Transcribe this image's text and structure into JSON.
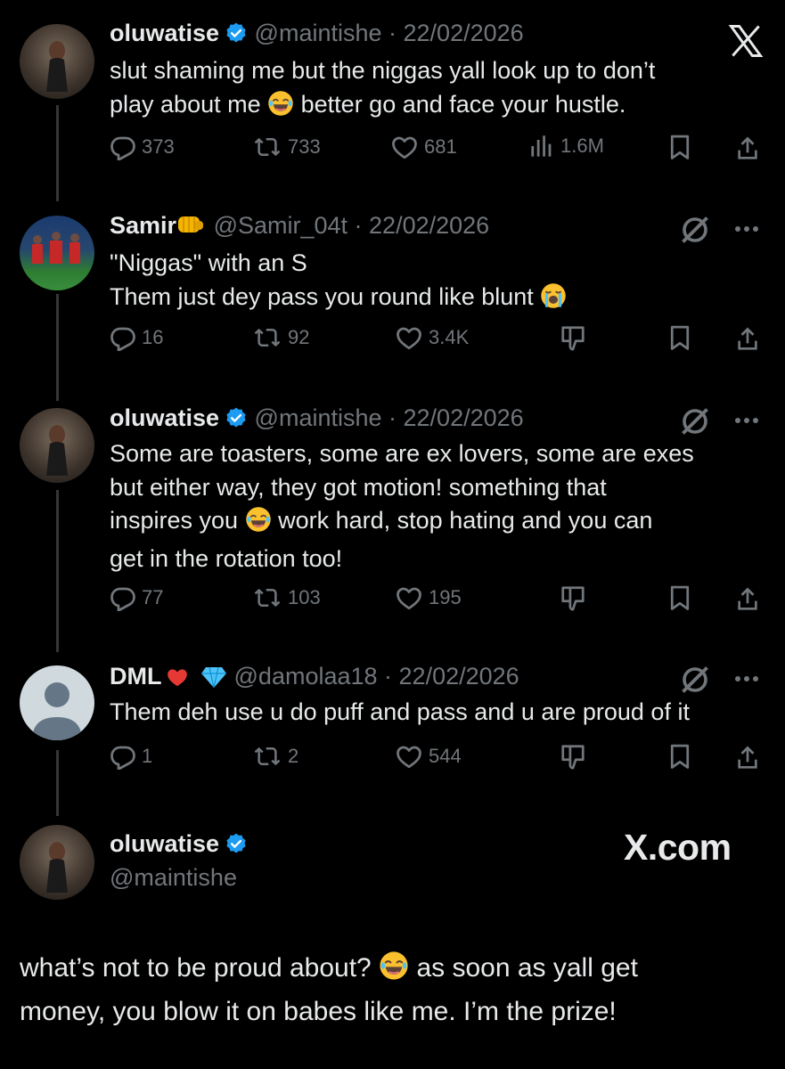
{
  "close_label": "X",
  "tweets": [
    {
      "name": "oluwatise",
      "handle": "@maintishe",
      "date": "22/02/2026",
      "text_a": "slut shaming me but the niggas yall look up to don’t",
      "text_b": "play about me",
      "text_c": "better go and face your hustle.",
      "replies": "373",
      "reposts": "733",
      "likes": "681",
      "views": "1.6M"
    },
    {
      "name": "Samir",
      "handle": "@Samir_04t",
      "date": "22/02/2026",
      "text_a": "\"Niggas\" with an S",
      "text_b": "Them just dey pass you round like blunt",
      "replies": "16",
      "reposts": "92",
      "likes": "3.4K"
    },
    {
      "name": "oluwatise",
      "handle": "@maintishe",
      "date": "22/02/2026",
      "text_a": "Some are toasters, some are ex lovers, some are exes",
      "text_b": "but either way, they got motion! something that",
      "text_c": "inspires you",
      "text_d": "work hard, stop hating and you can",
      "text_e": "get in the rotation too!",
      "replies": "77",
      "reposts": "103",
      "likes": "195"
    },
    {
      "name": "DML",
      "handle": "@damolaa18",
      "date": "22/02/2026",
      "text_a": "Them deh use u do puff and pass and u are proud of it",
      "replies": "1",
      "reposts": "2",
      "likes": "544"
    }
  ],
  "main": {
    "name": "oluwatise",
    "handle": "@maintishe",
    "brand": "X.com",
    "text_a": "what’s not to be proud about?",
    "text_b": "as soon as yall get",
    "text_c": "money, you blow it on babes like me. I’m the prize!"
  },
  "colors": {
    "verified": "#1d9bf0",
    "muted": "#71767b",
    "text": "#e7e9ea",
    "background": "#000000"
  }
}
